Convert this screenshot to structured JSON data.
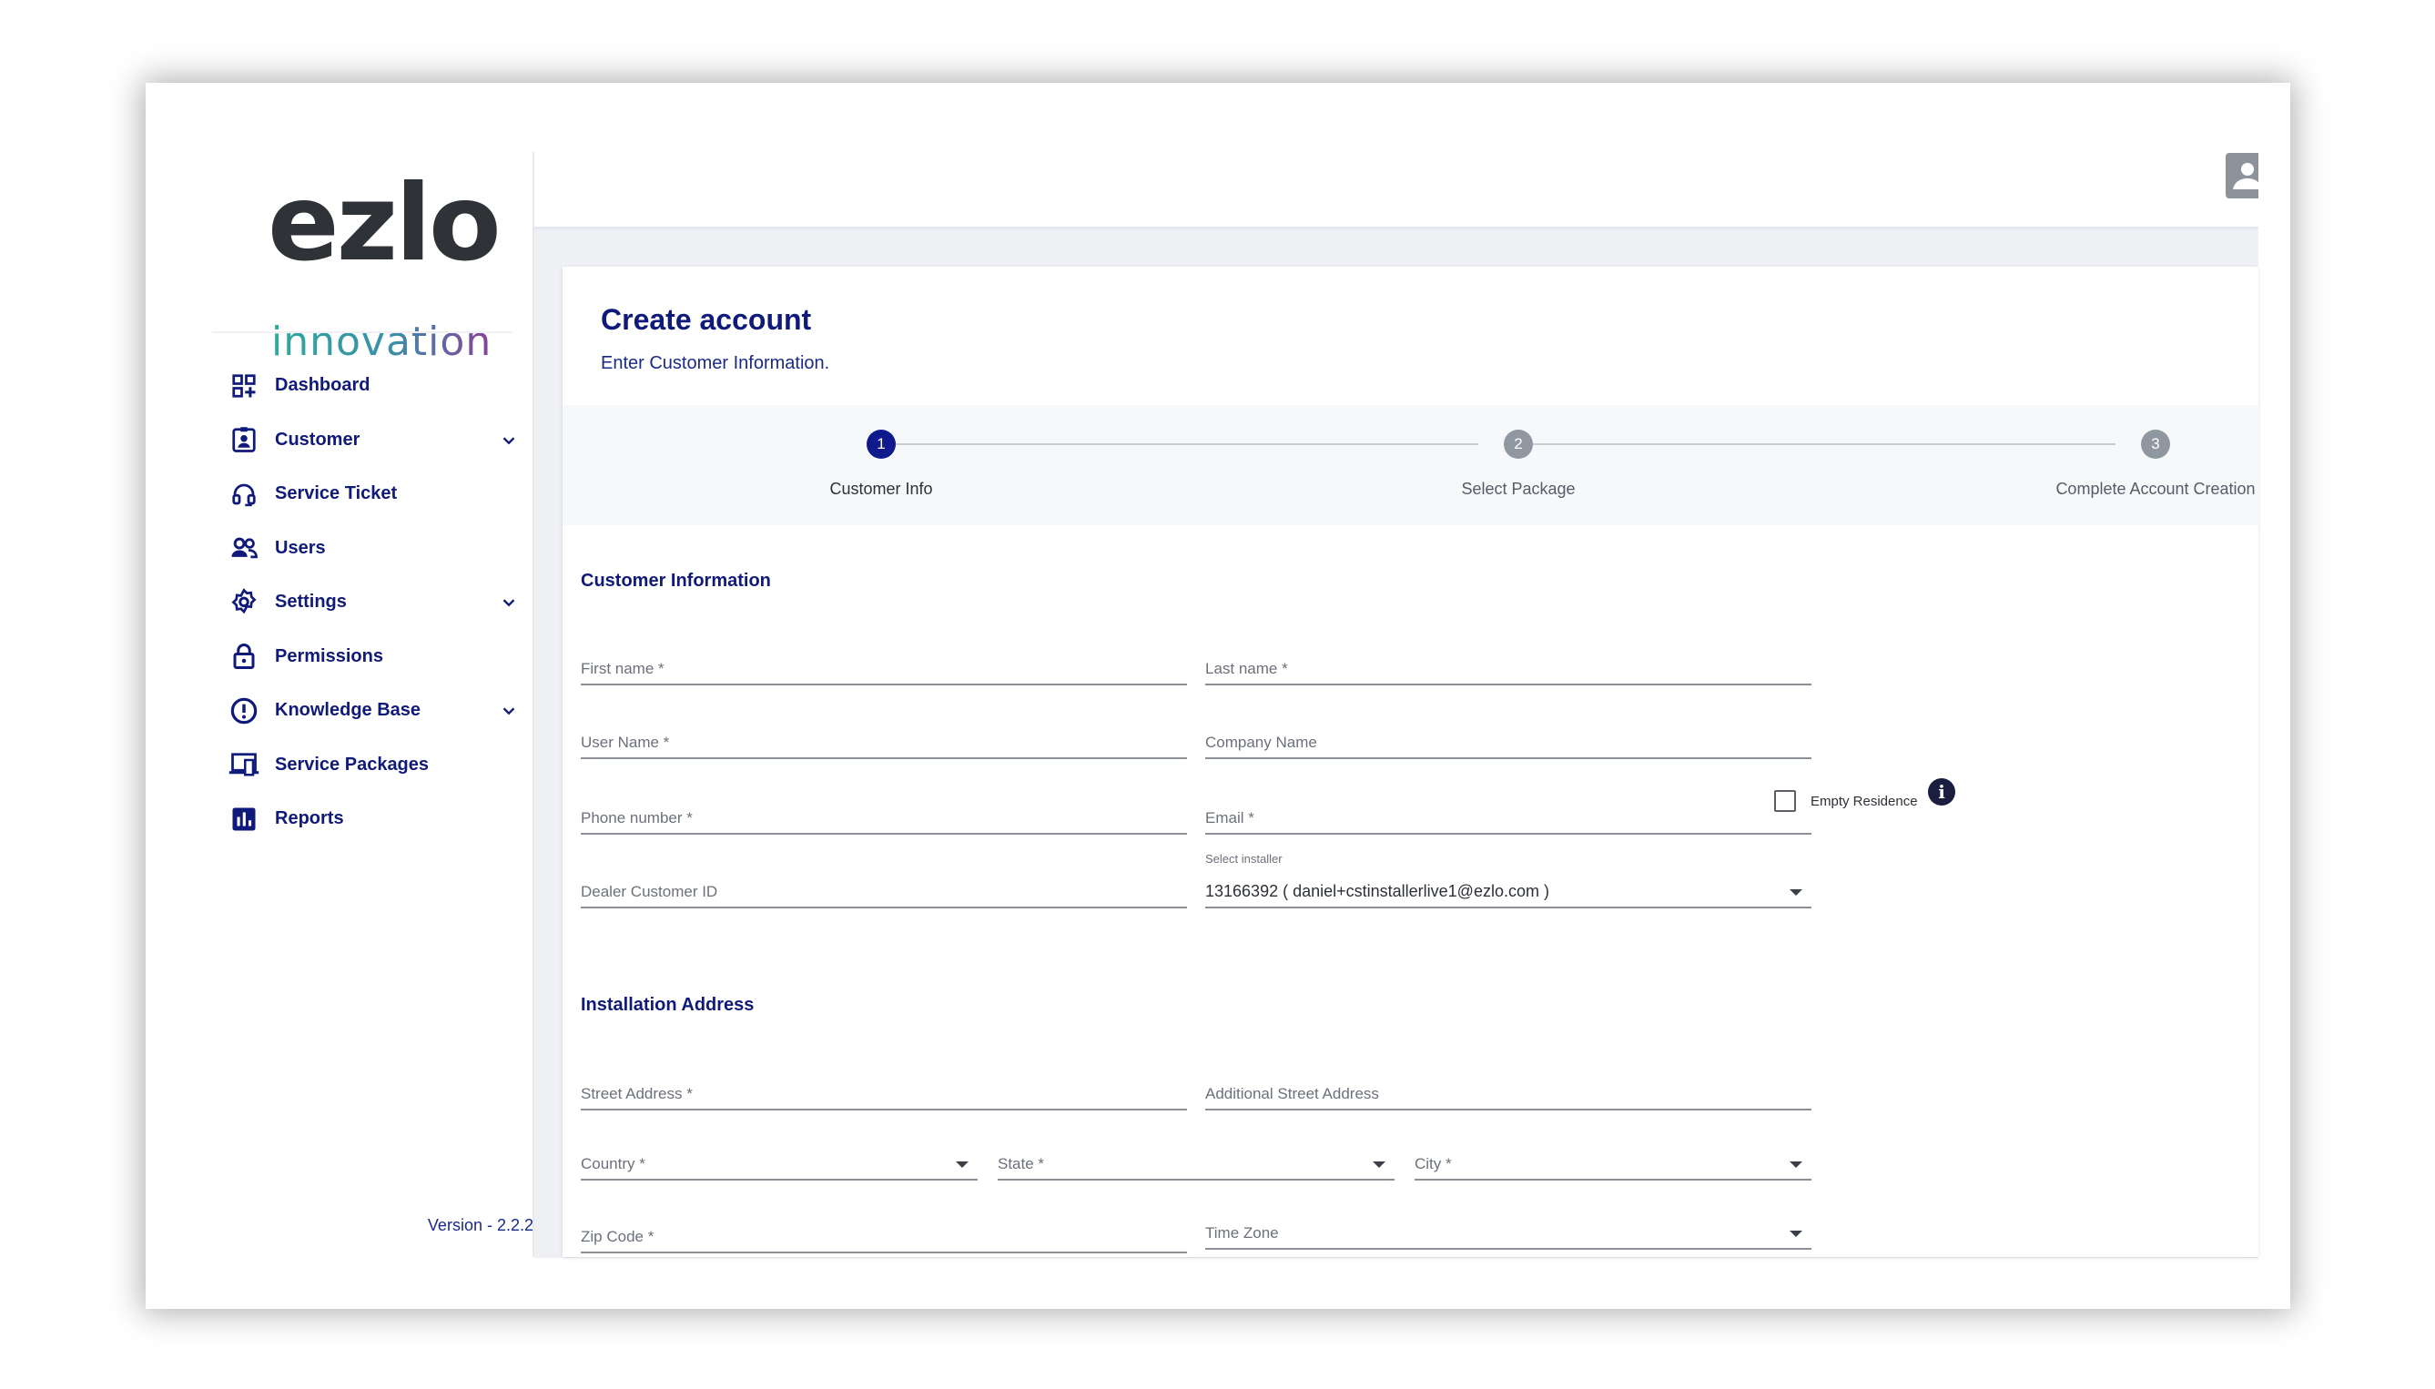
{
  "brand": {
    "logo_word": "ezlo",
    "logo_sub": "innovation"
  },
  "sidebar": {
    "items": [
      {
        "label": "Dashboard",
        "icon": "dashboard-icon",
        "has_chevron": false
      },
      {
        "label": "Customer",
        "icon": "customer-badge-icon",
        "has_chevron": true
      },
      {
        "label": "Service Ticket",
        "icon": "headset-icon",
        "has_chevron": false
      },
      {
        "label": "Users",
        "icon": "users-icon",
        "has_chevron": false
      },
      {
        "label": "Settings",
        "icon": "gear-icon",
        "has_chevron": true
      },
      {
        "label": "Permissions",
        "icon": "lock-icon",
        "has_chevron": false
      },
      {
        "label": "Knowledge Base",
        "icon": "alert-circle-icon",
        "has_chevron": true
      },
      {
        "label": "Service Packages",
        "icon": "devices-icon",
        "has_chevron": false
      },
      {
        "label": "Reports",
        "icon": "bar-chart-icon",
        "has_chevron": false
      }
    ],
    "version": "Version - 2.2.2"
  },
  "header": {
    "avatar_icon": "account-icon"
  },
  "page": {
    "title": "Create account",
    "subtitle": "Enter Customer Information."
  },
  "stepper": {
    "steps": [
      {
        "number": "1",
        "label": "Customer Info",
        "active": true
      },
      {
        "number": "2",
        "label": "Select Package",
        "active": false
      },
      {
        "number": "3",
        "label": "Complete Account Creation",
        "active": false
      }
    ]
  },
  "customer_section": {
    "title": "Customer Information",
    "first_name": "First name *",
    "last_name": "Last name *",
    "user_name": "User Name *",
    "company_name": "Company Name",
    "phone": "Phone number *",
    "email": "Email *",
    "empty_residence": "Empty Residence",
    "info_glyph": "i",
    "dealer_customer_id": "Dealer Customer ID",
    "select_installer_label": "Select installer",
    "select_installer_value": "13166392 ( daniel+cstinstallerlive1@ezlo.com )"
  },
  "address_section": {
    "title": "Installation Address",
    "street": "Street Address *",
    "additional_street": "Additional Street Address",
    "country": "Country *",
    "state": "State *",
    "city": "City *",
    "zip": "Zip Code *",
    "time_zone": "Time Zone"
  },
  "colors": {
    "primary_navy": "#101a7a",
    "step_active": "#0f1a8c",
    "step_inactive": "#9197a1",
    "page_bg": "#eef0f4"
  }
}
